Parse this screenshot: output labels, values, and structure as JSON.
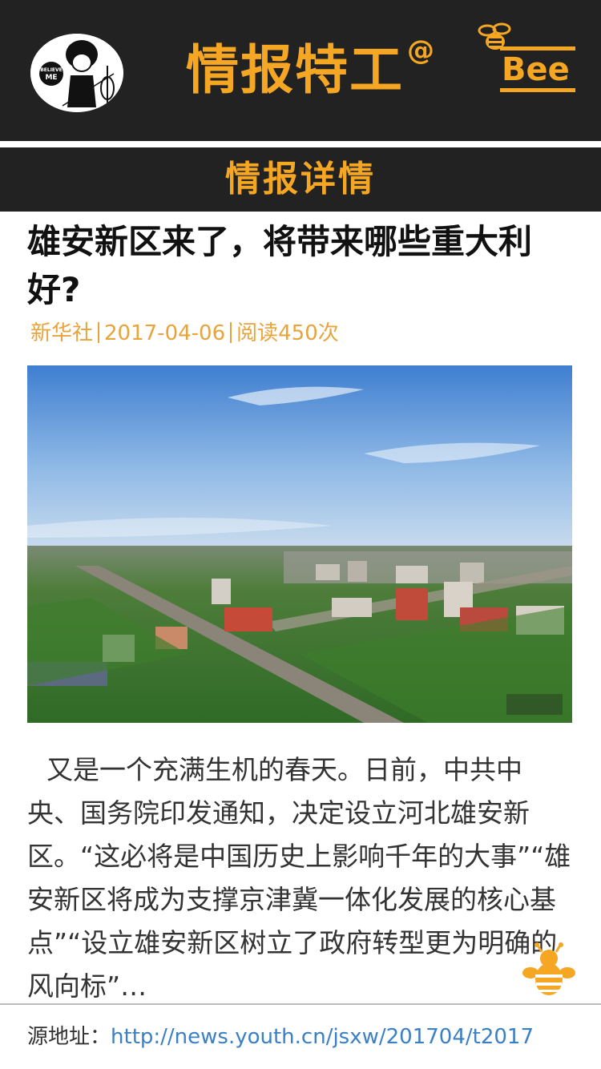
{
  "header": {
    "app_title": "情报特工",
    "app_title_suffix": "@",
    "brand_logo_text": "Bee",
    "avatar_badge": "BELIEVE ME",
    "bg_color": "#222222",
    "accent_color": "#f5a623"
  },
  "subheader": {
    "title": "情报详情"
  },
  "article": {
    "title": "雄安新区来了，将带来哪些重大利好?",
    "source": "新华社",
    "date": "2017-04-06",
    "read_count": "阅读450次",
    "image_icon": "aerial-city-photo",
    "body": "又是一个充满生机的春天。日前，中共中央、国务院印发通知，决定设立河北雄安新区。“这必将是中国历史上影响千年的大事”“雄安新区将成为支撑京津冀一体化发展的核心基点”“设立雄安新区树立了政府转型更为明确的风向标”…"
  },
  "footer": {
    "source_label": "源地址：",
    "source_url": "http://news.youth.cn/jsxw/201704/t2017"
  },
  "floating_button": {
    "icon": "bee-icon"
  }
}
